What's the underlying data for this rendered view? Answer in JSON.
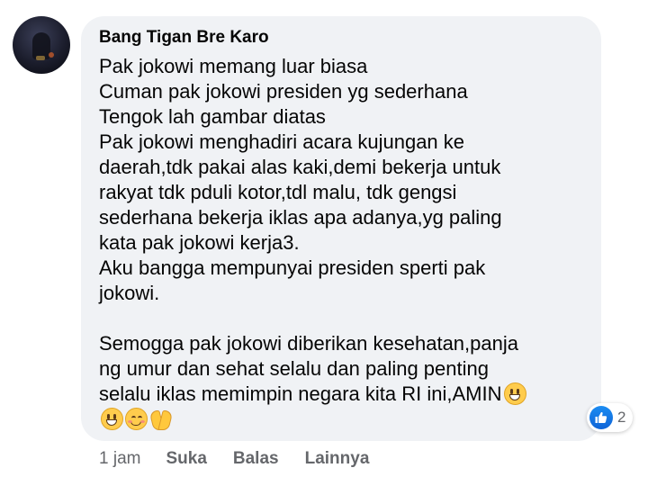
{
  "comment": {
    "author": "Bang Tigan Bre Karo",
    "lines": [
      "Pak jokowi memang luar biasa",
      "Cuman pak jokowi presiden yg sederhana",
      "Tengok lah gambar diatas",
      "Pak jokowi menghadiri acara kujungan ke",
      "daerah,tdk pakai alas kaki,demi bekerja untuk",
      "rakyat tdk pduli kotor,tdl malu, tdk gengsi",
      "sederhana bekerja iklas apa adanya,yg paling",
      "kata pak jokowi kerja3.",
      "Aku bangga mempunyai presiden sperti pak",
      "jokowi.",
      "",
      "Semogga pak jokowi diberikan kesehatan,panja",
      "ng umur dan sehat selalu dan paling penting",
      "selalu iklas memimpin negara kita RI ini,AMIN"
    ],
    "emoji": [
      "grinning-face-emoji",
      "grinning-face-emoji",
      "smiling-face-with-smiling-eyes-emoji",
      "folded-hands-emoji"
    ],
    "reactions": {
      "icon": "thumbs-up-icon",
      "count": "2",
      "color": "#1877f2"
    },
    "timestamp": "1 jam",
    "actions": {
      "like": "Suka",
      "reply": "Balas",
      "more": "Lainnya"
    }
  },
  "colors": {
    "bubble": "#f0f2f5",
    "text": "#050505",
    "meta": "#65676b"
  }
}
